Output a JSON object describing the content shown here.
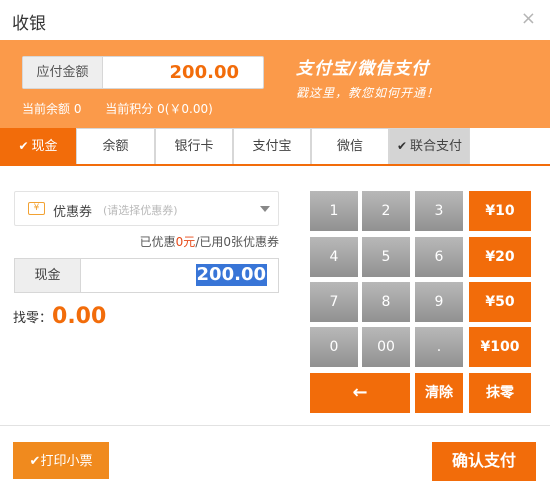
{
  "window": {
    "title": "收银",
    "close_glyph": "×"
  },
  "header": {
    "amount_label": "应付金额",
    "amount_value": "200.00",
    "balance_text": "当前余额 0",
    "points_text": "当前积分 0(￥0.00)",
    "pay_title": "支付宝/微信支付",
    "pay_sub": "戳这里，教您如何开通！"
  },
  "tabs": [
    {
      "label": "现金",
      "active": true
    },
    {
      "label": "余额"
    },
    {
      "label": "银行卡"
    },
    {
      "label": "支付宝"
    },
    {
      "label": "微信"
    },
    {
      "label": "联合支付",
      "checked": true
    }
  ],
  "coupon": {
    "icon_text": "¥",
    "label": "优惠券",
    "placeholder": "(请选择优惠券)",
    "used_prefix": "已优惠",
    "used_amount": "0元",
    "used_suffix": "/已用0张优惠券"
  },
  "cash": {
    "label": "现金",
    "value": "200.00"
  },
  "change": {
    "label": "找零：",
    "value": "0.00"
  },
  "keypad": {
    "k1": "1",
    "k2": "2",
    "k3": "3",
    "k4": "4",
    "k5": "5",
    "k6": "6",
    "k7": "7",
    "k8": "8",
    "k9": "9",
    "k0": "0",
    "k00": "00",
    "kdot": ".",
    "q10": "¥10",
    "q20": "¥20",
    "q50": "¥50",
    "q100": "¥100",
    "backspace": "←",
    "clear": "清除",
    "round": "抹零"
  },
  "footer": {
    "print_label": "打印小票",
    "confirm_label": "确认支付"
  },
  "colors": {
    "accent": "#f26c0a",
    "header_bg": "#fb9a4a",
    "key_gray": "#9e9e9e",
    "selection": "#3875d7"
  }
}
